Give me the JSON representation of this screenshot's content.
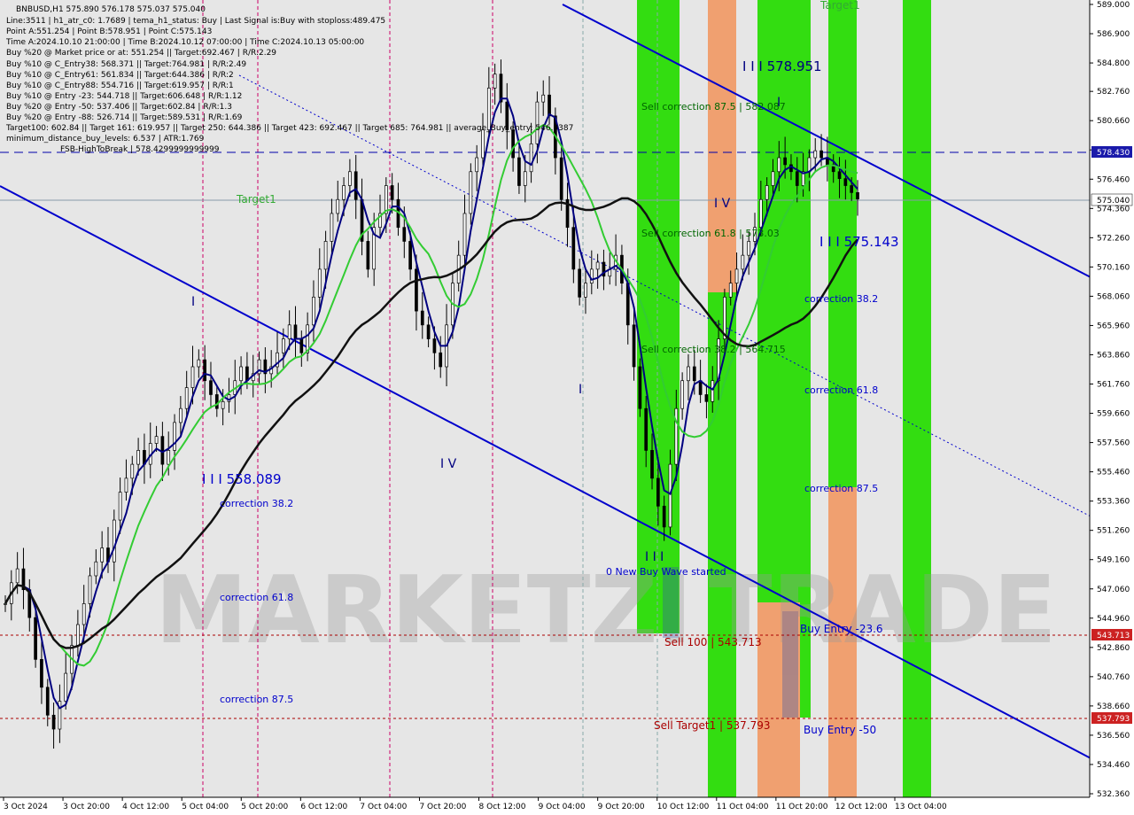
{
  "header": {
    "lines": [
      "BNBUSD,H1  575.890 576.178 575.037 575.040",
      "Line:3511  | h1_atr_c0: 1.7689  | tema_h1_status: Buy  | Last Signal is:Buy with stoploss:489.475",
      "Point A:551.254  | Point B:578.951  | Point C:575.143",
      "Time A:2024.10.10 21:00:00  | Time B:2024.10.12 07:00:00  | Time C:2024.10.13 05:00:00",
      "Buy %20 @ Market price or at: 551.254  || Target:692.467  | R/R:2.29",
      "Buy %10 @ C_Entry38: 568.371  || Target:764.981  | R/R:2.49",
      "Buy %10 @ C_Entry61: 561.834  || Target:644.386  | R/R:2",
      "Buy %10 @ C_Entry88: 554.716  || Target:619.957  | R/R:1",
      "Buy %10 @ Entry -23: 544.718  || Target:606.648  | R/R:1.12",
      "Buy %20 @ Entry -50: 537.406  || Target:602.84  | R/R:1.3",
      "Buy %20 @ Entry -88: 526.714  || Target:589.531  | R/R:1.69",
      "Target100: 602.84  || Target 161: 619.957  || Target 250: 644.386  || Target 423: 692.467  || Target 685: 764.981  || average_Buy_entry: 546.0387",
      "minimum_distance_buy_levels: 6.537  | ATR:1.769",
      "FSB-HighToBreak  | 578.4299999999999"
    ]
  },
  "watermark": {
    "left": "MARKETZI",
    "right": "TRADE"
  },
  "colors": {
    "background": "#e6e6e6",
    "green_zone": "#33dd11",
    "orange_zone": "#f0a070",
    "blue_line": "#0000cc",
    "ema_green": "#33cc33",
    "ema_black": "#111111",
    "red_dash": "#aa0000",
    "magenta": "#cc0066"
  },
  "annotations": [
    {
      "text": "Target1",
      "color": "#33aa33"
    },
    {
      "text": "Target1",
      "color": "#33aa33"
    },
    {
      "text": "I I I 578.951",
      "color": "#000080"
    },
    {
      "text": "Sell correction 87.5 | 582.087",
      "color": "#006600"
    },
    {
      "text": "Sell correction 61.8 | 573.03",
      "color": "#006600"
    },
    {
      "text": "Sell correction 38.2 | 564.715",
      "color": "#006600"
    },
    {
      "text": "I V",
      "color": "#000080"
    },
    {
      "text": "I I I 575.143",
      "color": "#0000cc"
    },
    {
      "text": "correction 38.2",
      "color": "#0000cc"
    },
    {
      "text": "correction 61.8",
      "color": "#0000cc"
    },
    {
      "text": "correction 87.5",
      "color": "#0000cc"
    },
    {
      "text": "I I I 558.089",
      "color": "#0000cc"
    },
    {
      "text": "correction 38.2",
      "color": "#0000cc"
    },
    {
      "text": "correction 61.8",
      "color": "#0000cc"
    },
    {
      "text": "correction 87.5",
      "color": "#0000cc"
    },
    {
      "text": "I V",
      "color": "#000080"
    },
    {
      "text": "I",
      "color": "#000080"
    },
    {
      "text": "I",
      "color": "#000080"
    },
    {
      "text": "I",
      "color": "#000080"
    },
    {
      "text": "I I I",
      "color": "#000080"
    },
    {
      "text": "0 New Buy Wave started",
      "color": "#0000cc"
    },
    {
      "text": "Sell 100 | 543.713",
      "color": "#aa0000"
    },
    {
      "text": "Sell Target1 | 537.793",
      "color": "#aa0000"
    },
    {
      "text": "Buy Entry -23.6",
      "color": "#0000cc"
    },
    {
      "text": "Buy Entry -50",
      "color": "#0000cc"
    }
  ],
  "price_tags": [
    {
      "value": "578.430",
      "bg": "#1a1aaa"
    },
    {
      "value": "575.040",
      "bg": "#ffffff"
    },
    {
      "value": "543.713",
      "bg": "#cc2222"
    },
    {
      "value": "537.793",
      "bg": "#cc2222"
    }
  ],
  "chart_data": {
    "type": "candlestick",
    "symbol": "BNBUSD",
    "timeframe": "H1",
    "ylim": [
      532.36,
      589.0
    ],
    "y_ticks": [
      "589.000",
      "586.900",
      "584.800",
      "582.760",
      "580.660",
      "578.560",
      "576.460",
      "574.360",
      "572.260",
      "570.160",
      "568.060",
      "565.960",
      "563.860",
      "561.760",
      "559.660",
      "557.560",
      "555.460",
      "553.360",
      "551.260",
      "549.160",
      "547.060",
      "544.960",
      "542.860",
      "540.760",
      "538.660",
      "536.560",
      "534.460",
      "532.360"
    ],
    "x_ticks": [
      "3 Oct 2024",
      "3 Oct 20:00",
      "4 Oct 12:00",
      "5 Oct 04:00",
      "5 Oct 20:00",
      "6 Oct 12:00",
      "7 Oct 04:00",
      "7 Oct 20:00",
      "8 Oct 12:00",
      "9 Oct 04:00",
      "9 Oct 20:00",
      "10 Oct 12:00",
      "11 Oct 04:00",
      "11 Oct 20:00",
      "12 Oct 12:00",
      "13 Oct 04:00"
    ],
    "levels": {
      "fsb_high_to_break": 578.43,
      "current": 575.04,
      "sell_100": 543.713,
      "sell_target1": 537.793
    },
    "series": [
      {
        "name": "close",
        "values": [
          546,
          547.5,
          548.5,
          547,
          545,
          542,
          540,
          538,
          537,
          539,
          541,
          543,
          544.5,
          546,
          548,
          549,
          550,
          549,
          552,
          554,
          555,
          556,
          557,
          556,
          557.5,
          558,
          556,
          557,
          559,
          560,
          561.5,
          563,
          563.5,
          562,
          561,
          560,
          560.5,
          561,
          562,
          563,
          562,
          562.5,
          563.5,
          562.5,
          563,
          564,
          565,
          566,
          565,
          564,
          566,
          568,
          570,
          572,
          574,
          575,
          576,
          577,
          575,
          572,
          570,
          573,
          574,
          576,
          575,
          573,
          572,
          570,
          567,
          566,
          565,
          564,
          563,
          566,
          569,
          571,
          574,
          577,
          578,
          580,
          583,
          584,
          582,
          580,
          578,
          576,
          577,
          579,
          582,
          582.5,
          581,
          578,
          575,
          573,
          570,
          568,
          569,
          570,
          570.5,
          569.5,
          570,
          571,
          569,
          566,
          563,
          560,
          557,
          555,
          553,
          551.5,
          556,
          560,
          562,
          563,
          562,
          561,
          560.5,
          562,
          565,
          568,
          569,
          570,
          571,
          572,
          573,
          575,
          576,
          577,
          578,
          577.5,
          577,
          576,
          577,
          578,
          578.5,
          578,
          577.5,
          577,
          576.5,
          576,
          575.5,
          575.04
        ]
      }
    ]
  }
}
